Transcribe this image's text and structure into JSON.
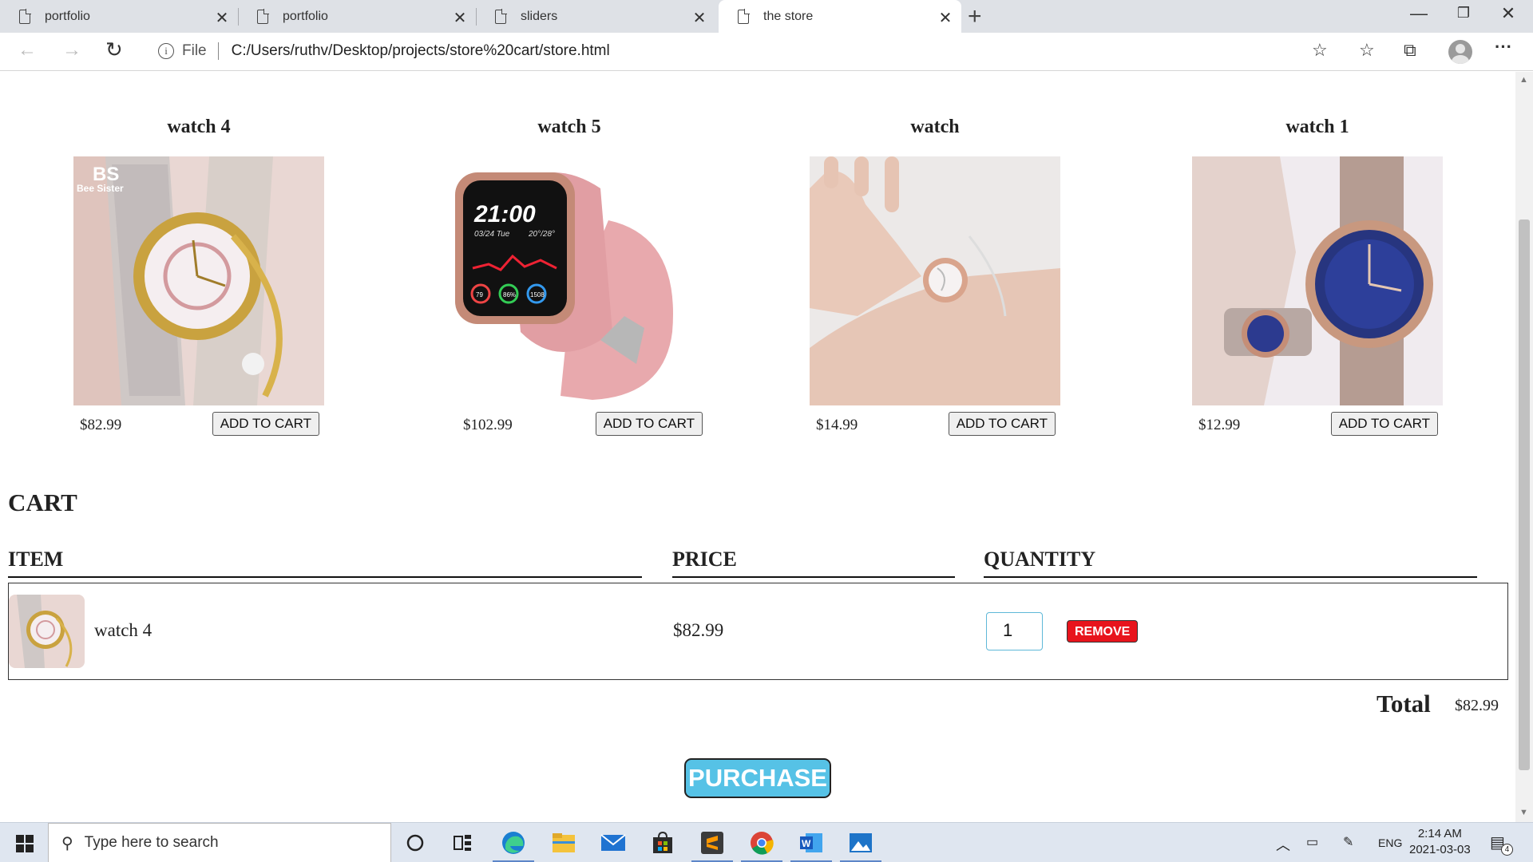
{
  "browser": {
    "tabs": [
      {
        "title": "portfolio",
        "active": false
      },
      {
        "title": "portfolio",
        "active": false
      },
      {
        "title": "sliders",
        "active": false
      },
      {
        "title": "the store",
        "active": true
      }
    ],
    "file_label": "File",
    "url": "C:/Users/ruthv/Desktop/projects/store%20cart/store.html"
  },
  "store": {
    "products": [
      {
        "title": "watch 4",
        "price": "$82.99",
        "button": "ADD TO CART"
      },
      {
        "title": "watch 5",
        "price": "$102.99",
        "button": "ADD TO CART"
      },
      {
        "title": "watch",
        "price": "$14.99",
        "button": "ADD TO CART"
      },
      {
        "title": "watch 1",
        "price": "$12.99",
        "button": "ADD TO CART"
      }
    ],
    "watch5_screen": {
      "time": "21:00",
      "date": "03/24 Tue",
      "temp": "20°/28°",
      "ring1": "79",
      "ring2": "86%",
      "ring3": "1508"
    },
    "brand_overlay": {
      "logo": "BS",
      "name": "Bee Sister"
    }
  },
  "cart": {
    "heading": "CART",
    "columns": {
      "item": "ITEM",
      "price": "PRICE",
      "quantity": "QUANTITY"
    },
    "rows": [
      {
        "name": "watch 4",
        "price": "$82.99",
        "quantity": "1",
        "remove_label": "REMOVE"
      }
    ],
    "total_label": "Total",
    "total_value": "$82.99",
    "purchase_label": "PURCHASE"
  },
  "taskbar": {
    "search_placeholder": "Type here to search",
    "language": "ENG",
    "time": "2:14 AM",
    "date": "2021-03-03",
    "notification_count": "4"
  },
  "colors": {
    "purchase": "#56c2e6",
    "remove": "#e8141c",
    "qty_border": "#5fb8d8"
  }
}
